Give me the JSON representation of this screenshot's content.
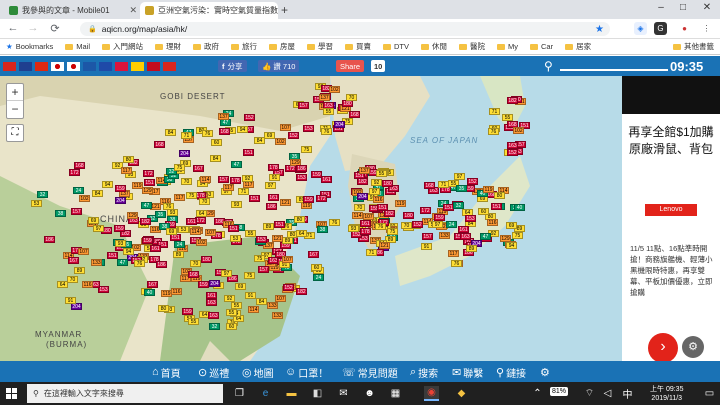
{
  "browser": {
    "tabs": [
      {
        "title": "我參與的文章 - Mobile01",
        "active": false,
        "favicon_color": "#2e8b3a"
      },
      {
        "title": "亞洲空氣污染：實時空氣質量指數...",
        "active": true,
        "favicon_color": "#c9a227"
      }
    ],
    "new_tab": "+",
    "window_controls": {
      "minimize": "–",
      "maximize": "□",
      "close": "✕"
    },
    "address": {
      "lock": "🔒",
      "url": "aqicn.org/map/asia/hk/"
    },
    "nav": {
      "back": "←",
      "forward": "→",
      "reload": "⟳"
    },
    "bookmarks": [
      {
        "label": "Bookmarks",
        "type": "star"
      },
      {
        "label": "Mail",
        "type": "folder"
      },
      {
        "label": "入門網站",
        "type": "folder"
      },
      {
        "label": "理財",
        "type": "folder"
      },
      {
        "label": "政府",
        "type": "folder"
      },
      {
        "label": "旅行",
        "type": "folder"
      },
      {
        "label": "房屋",
        "type": "folder"
      },
      {
        "label": "學習",
        "type": "folder"
      },
      {
        "label": "買賣",
        "type": "folder"
      },
      {
        "label": "DTV",
        "type": "folder"
      },
      {
        "label": "休閒",
        "type": "folder"
      },
      {
        "label": "醫院",
        "type": "folder"
      },
      {
        "label": "My",
        "type": "folder"
      },
      {
        "label": "Car",
        "type": "folder"
      },
      {
        "label": "居家",
        "type": "folder"
      },
      {
        "label": "其他書籤",
        "type": "folder"
      }
    ]
  },
  "site": {
    "flags": [
      {
        "name": "flag-vn",
        "color": "#da251d"
      },
      {
        "name": "flag-uk",
        "color": "#1f3f8f"
      },
      {
        "name": "flag-cn",
        "color": "#de2910"
      },
      {
        "name": "flag-jp",
        "color": "#ffffff"
      },
      {
        "name": "flag-kr",
        "color": "#ffffff"
      },
      {
        "name": "flag-ru",
        "color": "#1c57a7"
      },
      {
        "name": "flag-fr",
        "color": "#1f4aa8"
      },
      {
        "name": "flag-pl",
        "color": "#dc143c"
      },
      {
        "name": "flag-de",
        "color": "#ffce00"
      },
      {
        "name": "flag-es",
        "color": "#c60b1e"
      },
      {
        "name": "flag-vn2",
        "color": "#da251d"
      }
    ],
    "fb_share": "分享",
    "fb_like": "讚 710",
    "share_label": "Share",
    "share_count": "10",
    "clock": "09:35"
  },
  "map": {
    "labels": {
      "gobi": "GOBI DESERT",
      "china": "CHINA",
      "myanmar": "MYANMAR",
      "burma": "(BURMA)",
      "seaofjapan": "SEA OF JAPAN"
    },
    "zoom_in": "+",
    "zoom_out": "−",
    "fullscreen": "⛶",
    "aqi_colors": {
      "good": "#009966",
      "moderate": "#ffde33",
      "sensitive": "#ff9933",
      "unhealthy": "#cc0033",
      "very_unhealthy": "#660099"
    },
    "sample_readings": [
      "91",
      "97",
      "89",
      "80",
      "84",
      "64",
      "53",
      "38",
      "92",
      "117",
      "172",
      "161",
      "159",
      "186",
      "178",
      "167",
      "133",
      "151",
      "116",
      "107",
      "102",
      "93",
      "76",
      "70",
      "60",
      "55",
      "75",
      "71",
      "151",
      "137",
      "121",
      "182",
      "204",
      "180",
      "153",
      "157",
      "163",
      "152",
      "159",
      "168",
      "129",
      "119",
      "69",
      "47",
      "32",
      "35",
      "40",
      "24",
      "94",
      "114"
    ]
  },
  "ad": {
    "title": "再享全館$1加購原廠滑鼠、背包",
    "brand": "Lenovo",
    "body": "11/5 11點、16點準時開搶！商務旗艦機、輕薄小黑機限時特惠，再享雙幕、平板加價優惠，立即搶購",
    "arrow": "›",
    "settings_icon": "⚙"
  },
  "bottom_nav": {
    "items": [
      {
        "icon": "⌂",
        "label": "首頁"
      },
      {
        "icon": "⊙",
        "label": "巡禮"
      },
      {
        "icon": "◎",
        "label": "地圖"
      },
      {
        "icon": "☺",
        "label": "口罩！"
      },
      {
        "icon": "☏",
        "label": "常見問題"
      },
      {
        "icon": "⌕",
        "label": "搜索"
      },
      {
        "icon": "✉",
        "label": "聯繫"
      },
      {
        "icon": "⚲",
        "label": "鏈接"
      },
      {
        "icon": "⚙",
        "label": ""
      }
    ]
  },
  "taskbar": {
    "search_placeholder": "在這裡輸入文字來搜尋",
    "battery": "81%",
    "time": "上午 09:35",
    "date": "2019/11/3"
  }
}
